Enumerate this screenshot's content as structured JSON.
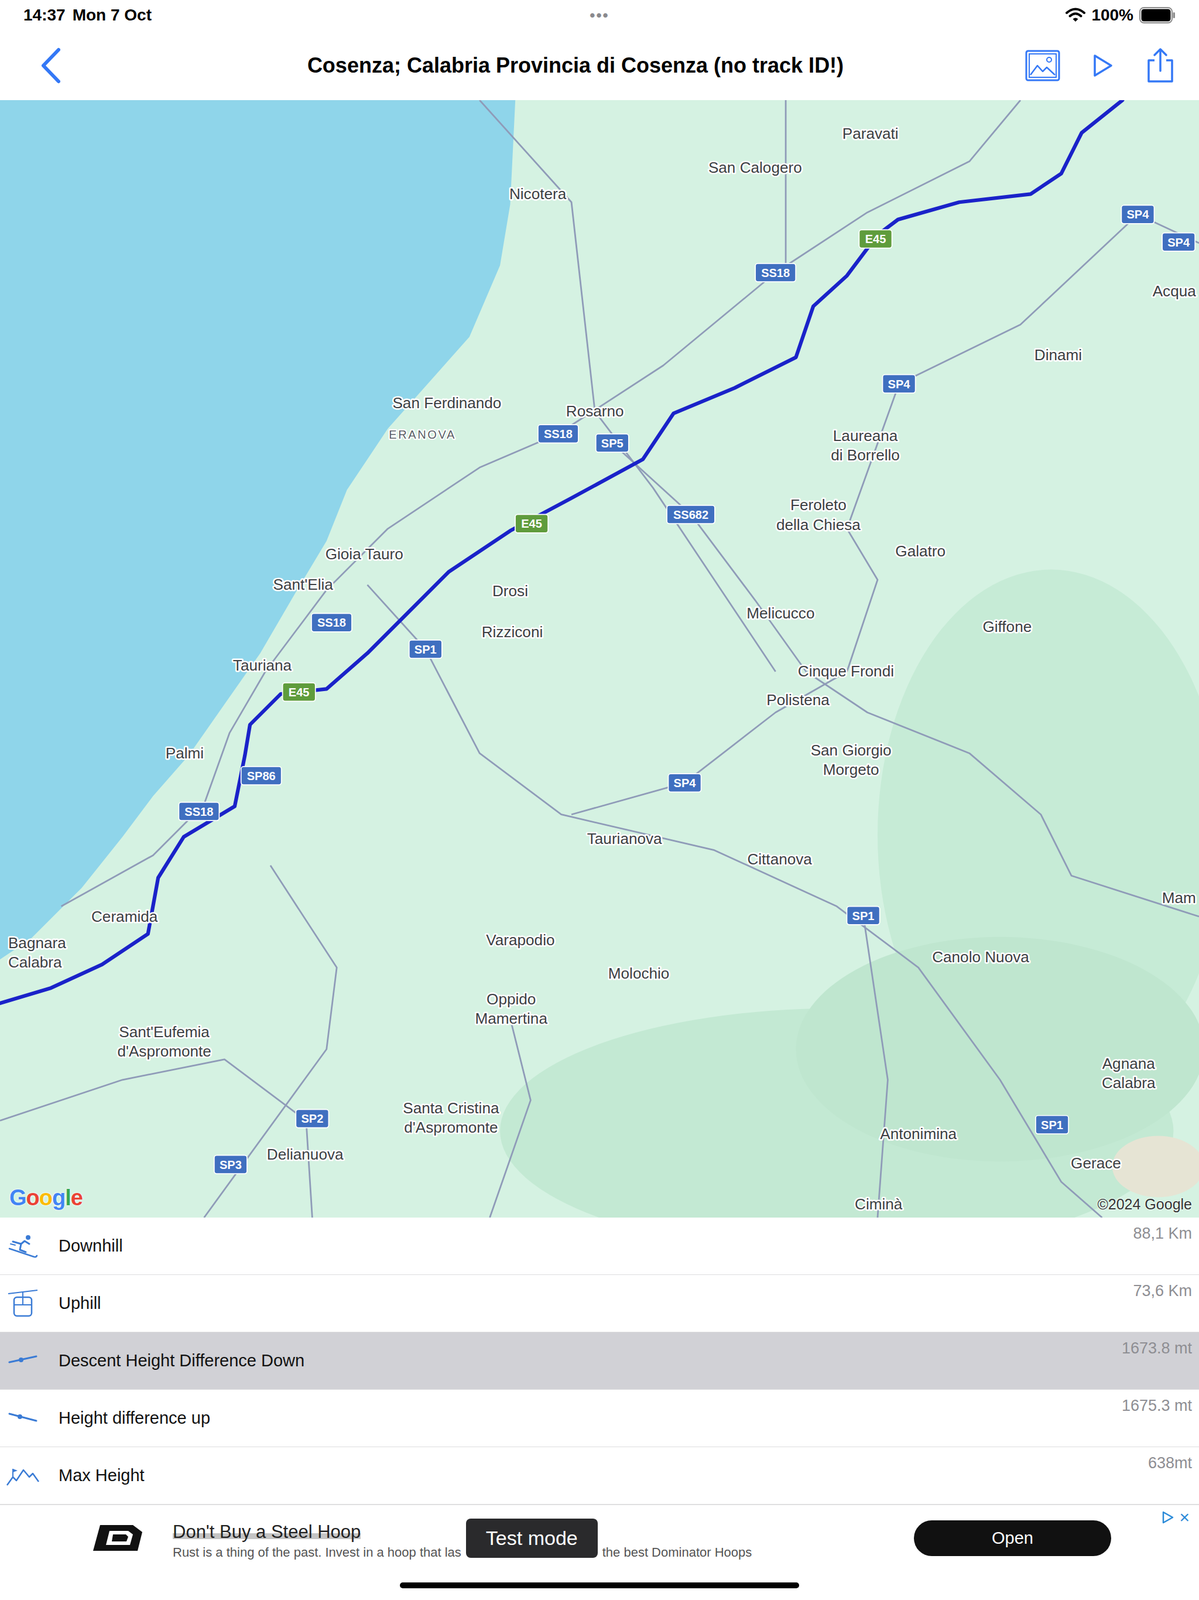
{
  "status_bar": {
    "time": "14:37",
    "date": "Mon 7 Oct",
    "dots": "•••",
    "battery_text": "100%",
    "battery_level": 1
  },
  "nav": {
    "title": "Cosenza; Calabria Provincia di Cosenza (no track ID!)"
  },
  "map": {
    "places": [
      {
        "lines": [
          "Paravati"
        ],
        "kind": "town"
      },
      {
        "lines": [
          "San Calogero"
        ],
        "kind": "town"
      },
      {
        "lines": [
          "Nicotera"
        ],
        "kind": "town"
      },
      {
        "lines": [
          "Acqua"
        ],
        "kind": "town"
      },
      {
        "lines": [
          "Dinami"
        ],
        "kind": "town"
      },
      {
        "lines": [
          "San Ferdinando"
        ],
        "kind": "town"
      },
      {
        "lines": [
          "Rosarno"
        ],
        "kind": "town"
      },
      {
        "lines": [
          "ERANOVA"
        ],
        "kind": "area"
      },
      {
        "lines": [
          "Laureana",
          "di Borrello"
        ],
        "kind": "town"
      },
      {
        "lines": [
          "Feroleto",
          "della Chiesa"
        ],
        "kind": "town"
      },
      {
        "lines": [
          "Galatro"
        ],
        "kind": "town"
      },
      {
        "lines": [
          "Gioia Tauro"
        ],
        "kind": "town"
      },
      {
        "lines": [
          "Sant'Elia"
        ],
        "kind": "town"
      },
      {
        "lines": [
          "Drosi"
        ],
        "kind": "town"
      },
      {
        "lines": [
          "Rizziconi"
        ],
        "kind": "town"
      },
      {
        "lines": [
          "Melicucco"
        ],
        "kind": "town"
      },
      {
        "lines": [
          "Giffone"
        ],
        "kind": "town"
      },
      {
        "lines": [
          "Tauriana"
        ],
        "kind": "town"
      },
      {
        "lines": [
          "Cinque Frondi"
        ],
        "kind": "town"
      },
      {
        "lines": [
          "Polistena"
        ],
        "kind": "town"
      },
      {
        "lines": [
          "San Giorgio",
          "Morgeto"
        ],
        "kind": "town"
      },
      {
        "lines": [
          "Palmi"
        ],
        "kind": "town"
      },
      {
        "lines": [
          "Taurianova"
        ],
        "kind": "town"
      },
      {
        "lines": [
          "Cittanova"
        ],
        "kind": "town"
      },
      {
        "lines": [
          "Mam"
        ],
        "kind": "town"
      },
      {
        "lines": [
          "Ceramida"
        ],
        "kind": "town"
      },
      {
        "lines": [
          "Bagnara",
          "Calabra"
        ],
        "kind": "town"
      },
      {
        "lines": [
          "Varapodio"
        ],
        "kind": "town"
      },
      {
        "lines": [
          "Molochio"
        ],
        "kind": "town"
      },
      {
        "lines": [
          "Canolo Nuova"
        ],
        "kind": "town"
      },
      {
        "lines": [
          "Oppido",
          "Mamertina"
        ],
        "kind": "town"
      },
      {
        "lines": [
          "Sant'Eufemia",
          "d'Aspromonte"
        ],
        "kind": "town"
      },
      {
        "lines": [
          "Agnana",
          "Calabra"
        ],
        "kind": "town"
      },
      {
        "lines": [
          "Santa Cristina",
          "d'Aspromonte"
        ],
        "kind": "town"
      },
      {
        "lines": [
          "Delianuova"
        ],
        "kind": "town"
      },
      {
        "lines": [
          "Antonimina"
        ],
        "kind": "town"
      },
      {
        "lines": [
          "Gerace"
        ],
        "kind": "town"
      },
      {
        "lines": [
          "Ciminà"
        ],
        "kind": "town"
      }
    ],
    "road_badges": [
      {
        "label": "SP4",
        "color": "#3f6fc0"
      },
      {
        "label": "SP4",
        "color": "#3f6fc0"
      },
      {
        "label": "E45",
        "color": "#5f9c3c"
      },
      {
        "label": "SS18",
        "color": "#3f6fc0"
      },
      {
        "label": "SP4",
        "color": "#3f6fc0"
      },
      {
        "label": "SS18",
        "color": "#3f6fc0"
      },
      {
        "label": "SP5",
        "color": "#3f6fc0"
      },
      {
        "label": "E45",
        "color": "#5f9c3c"
      },
      {
        "label": "SS682",
        "color": "#3f6fc0"
      },
      {
        "label": "SS18",
        "color": "#3f6fc0"
      },
      {
        "label": "SP1",
        "color": "#3f6fc0"
      },
      {
        "label": "E45",
        "color": "#5f9c3c"
      },
      {
        "label": "SP86",
        "color": "#3f6fc0"
      },
      {
        "label": "SS18",
        "color": "#3f6fc0"
      },
      {
        "label": "SP4",
        "color": "#3f6fc0"
      },
      {
        "label": "SP1",
        "color": "#3f6fc0"
      },
      {
        "label": "SP2",
        "color": "#3f6fc0"
      },
      {
        "label": "SP3",
        "color": "#3f6fc0"
      },
      {
        "label": "SP1",
        "color": "#3f6fc0"
      }
    ],
    "logo": "Google",
    "copyright": "©2024 Google"
  },
  "stats": [
    {
      "label": "Downhill",
      "value": "88,1 Km",
      "selected": false
    },
    {
      "label": "Uphill",
      "value": "73,6 Km",
      "selected": false
    },
    {
      "label": "Descent Height Difference Down",
      "value": "1673.8 mt",
      "selected": true
    },
    {
      "label": "Height difference up",
      "value": "1675.3 mt",
      "selected": false
    },
    {
      "label": "Max Height",
      "value": "638mt",
      "selected": false
    }
  ],
  "ad": {
    "title": "Don't Buy a Steel Hoop",
    "text_start": "Rust is a thing of the past. Invest in a hoop that las",
    "text_end": "the best Dominator Hoops",
    "button": "Open",
    "close": "×"
  },
  "test_mode": {
    "label": "Test mode"
  }
}
